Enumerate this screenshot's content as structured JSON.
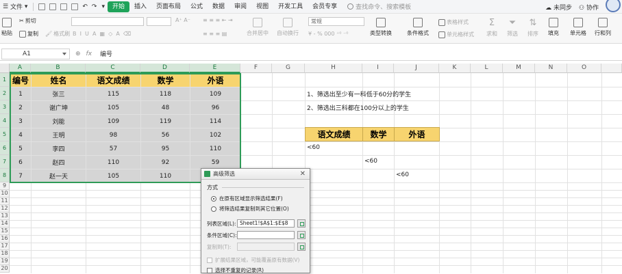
{
  "menu": {
    "file_label": "文件",
    "tabs": [
      "开始",
      "插入",
      "页面布局",
      "公式",
      "数据",
      "审阅",
      "视图",
      "开发工具",
      "会员专享"
    ],
    "active_tab": "开始",
    "search_placeholder": "查找命令、搜索模板",
    "sync_label": "未同步",
    "collab_label": "协作"
  },
  "ribbon": {
    "paste": "粘贴",
    "cut": "剪切",
    "copy": "复制",
    "format_painter": "格式刷",
    "merge_center": "合并居中",
    "wrap": "自动换行",
    "number_format": "常规",
    "type_convert": "类型转换",
    "conditional_format": "条件格式",
    "table_style": "表格样式",
    "cell_style": "单元格样式",
    "sum": "求和",
    "filter": "筛选",
    "sort": "排序",
    "fill": "填充",
    "cell": "单元格",
    "row_col": "行和列"
  },
  "formula_bar": {
    "cell_ref": "A1",
    "content": "编号"
  },
  "columns": [
    "A",
    "B",
    "C",
    "D",
    "E",
    "F",
    "G",
    "H",
    "I",
    "J",
    "K",
    "L",
    "M",
    "N",
    "O"
  ],
  "rows": [
    "1",
    "2",
    "3",
    "4",
    "5",
    "6",
    "7",
    "8",
    "9",
    "10",
    "11",
    "12",
    "13",
    "14",
    "15",
    "16",
    "17",
    "18",
    "19",
    "20"
  ],
  "table": {
    "headers": [
      "编号",
      "姓名",
      "语文成绩",
      "数学",
      "外语"
    ],
    "rows": [
      [
        "1",
        "张三",
        "115",
        "118",
        "109"
      ],
      [
        "2",
        "谢广坤",
        "105",
        "48",
        "96"
      ],
      [
        "3",
        "刘能",
        "109",
        "119",
        "114"
      ],
      [
        "4",
        "王明",
        "98",
        "56",
        "102"
      ],
      [
        "5",
        "李四",
        "57",
        "95",
        "110"
      ],
      [
        "6",
        "赵四",
        "110",
        "92",
        "59"
      ],
      [
        "7",
        "赵一天",
        "105",
        "110",
        "55"
      ]
    ]
  },
  "notes": [
    "1、筛选出至少有一科低于60分的学生",
    "2、筛选出三科都在100分以上的学生"
  ],
  "criteria": {
    "headers": [
      "语文成绩",
      "数学",
      "外语"
    ],
    "values": [
      "<60",
      "<60",
      "<60"
    ]
  },
  "dialog": {
    "title": "高级筛选",
    "section": "方式",
    "option1": "在原有区域显示筛选结果(F)",
    "option2": "将筛选结果复制到其它位置(O)",
    "list_label": "列表区域(L):",
    "list_value": "Sheet1!$A$1:$E$8",
    "criteria_label": "条件区域(C):",
    "criteria_value": "",
    "copyto_label": "复制到(T):",
    "expand_label": "扩展结果区域，可能覆盖原有数据(V)",
    "unique_label": "选择不重复的记录(R)"
  }
}
